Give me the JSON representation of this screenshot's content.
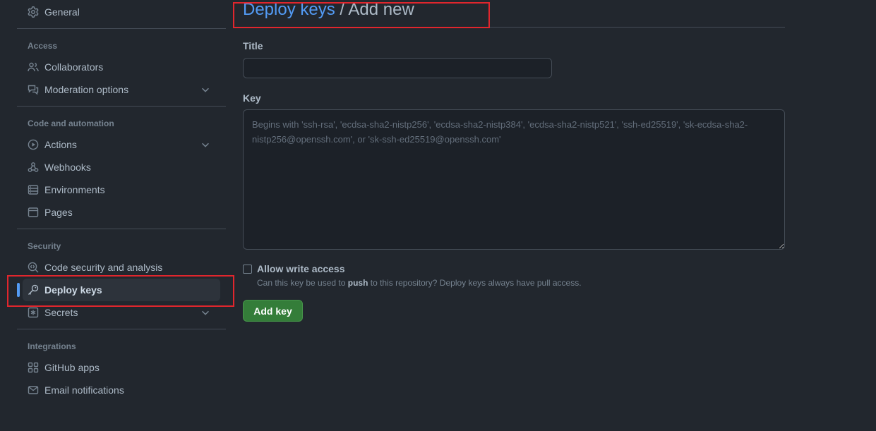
{
  "sidebar": {
    "general": {
      "label": "General",
      "icon": "gear-icon"
    },
    "sections": {
      "access": {
        "title": "Access"
      },
      "code_automation": {
        "title": "Code and automation"
      },
      "security": {
        "title": "Security"
      },
      "integrations": {
        "title": "Integrations"
      }
    },
    "items": {
      "collaborators": {
        "label": "Collaborators",
        "icon": "people-icon"
      },
      "moderation": {
        "label": "Moderation options",
        "icon": "comment-discussion-icon"
      },
      "actions": {
        "label": "Actions",
        "icon": "play-icon"
      },
      "webhooks": {
        "label": "Webhooks",
        "icon": "webhook-icon"
      },
      "environments": {
        "label": "Environments",
        "icon": "server-icon"
      },
      "pages": {
        "label": "Pages",
        "icon": "browser-icon"
      },
      "code_security": {
        "label": "Code security and analysis",
        "icon": "codescan-icon"
      },
      "deploy_keys": {
        "label": "Deploy keys",
        "icon": "key-icon",
        "active": true
      },
      "secrets": {
        "label": "Secrets",
        "icon": "asterisk-icon"
      },
      "github_apps": {
        "label": "GitHub apps",
        "icon": "apps-icon"
      },
      "email_notifications": {
        "label": "Email notifications",
        "icon": "mail-icon"
      }
    }
  },
  "main": {
    "breadcrumb": {
      "link": "Deploy keys",
      "separator": " / ",
      "current": "Add new"
    },
    "form": {
      "title_label": "Title",
      "title_value": "",
      "key_label": "Key",
      "key_placeholder": "Begins with 'ssh-rsa', 'ecdsa-sha2-nistp256', 'ecdsa-sha2-nistp384', 'ecdsa-sha2-nistp521', 'ssh-ed25519', 'sk-ecdsa-sha2-nistp256@openssh.com', or 'sk-ssh-ed25519@openssh.com'",
      "write_access_label": "Allow write access",
      "write_access_checked": false,
      "hint_before": "Can this key be used to ",
      "hint_bold": "push",
      "hint_after": " to this repository? Deploy keys always have pull access.",
      "submit_label": "Add key"
    }
  },
  "colors": {
    "background": "#22272e",
    "accent": "#539bf5",
    "primary_button": "#347d39",
    "annotation": "#e0262d"
  }
}
